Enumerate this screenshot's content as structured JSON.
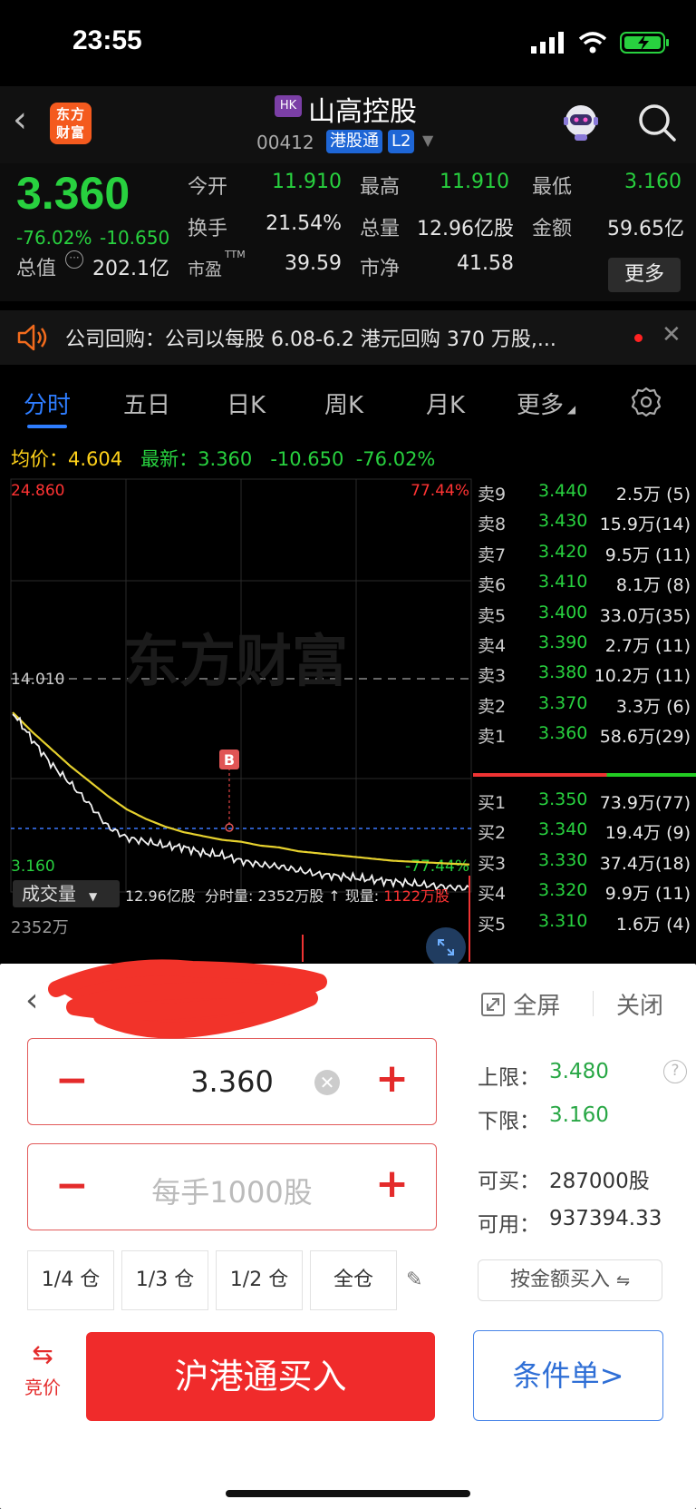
{
  "status_bar": {
    "time": "23:55"
  },
  "header": {
    "logo_text_line1": "东方",
    "logo_text_line2": "财富",
    "market_badge": "HK",
    "stock_name": "山高控股",
    "stock_code": "00412",
    "tag_connect": "港股通",
    "tag_level": "L2"
  },
  "quote": {
    "price": "3.360",
    "change_pct": "-76.02%",
    "change_abs": "-10.650",
    "open_label": "今开",
    "open": "11.910",
    "high_label": "最高",
    "high": "11.910",
    "low_label": "最低",
    "low": "3.160",
    "turnover_label": "换手",
    "turnover": "21.54%",
    "volume_label": "总量",
    "volume": "12.96亿股",
    "amount_label": "金额",
    "amount": "59.65亿",
    "mktcap_label": "总值",
    "mktcap": "202.1亿",
    "pe_label": "市盈",
    "pe_sup": "TTM",
    "pe": "39.59",
    "pb_label": "市净",
    "pb": "41.58",
    "more": "更多"
  },
  "notice": {
    "text": "公司回购：公司以每股 6.08-6.2 港元回购 370 万股,..."
  },
  "tabs": [
    "分时",
    "五日",
    "日K",
    "周K",
    "月K",
    "更多"
  ],
  "chart": {
    "avg_label": "均价：",
    "avg_value": "4.604",
    "latest_label": "最新：",
    "latest_value": "3.360",
    "latest_chg": "-10.650",
    "latest_pct": "-76.02%",
    "y_top": "24.860",
    "y_mid": "14.010",
    "y_bottom": "3.160",
    "pct_top": "77.44%",
    "pct_bottom": "-77.44%",
    "watermark": "东方财富",
    "marker": "B",
    "volume_btn": "成交量",
    "volume_info_total": "12.96亿股",
    "volume_info_tick_label": "分时量:",
    "volume_info_tick": "2352万股",
    "volume_info_now_label": "现量:",
    "volume_info_now": "1122万股",
    "volume_axis_max": "2352万"
  },
  "chart_data": {
    "type": "line",
    "title": "",
    "xlabel": "",
    "ylabel": "",
    "ylim": [
      3.16,
      24.86
    ],
    "series": [
      {
        "name": "最新",
        "values": [
          12.6,
          11.2,
          9.9,
          8.9,
          7.8,
          6.6,
          6.0,
          5.8,
          5.6,
          5.5,
          5.2,
          5.1,
          4.8,
          4.6,
          4.5,
          4.3,
          4.1,
          4.0,
          3.9,
          3.8,
          3.7,
          3.6,
          3.5,
          3.4,
          3.36
        ]
      },
      {
        "name": "均价",
        "values": [
          12.6,
          11.6,
          10.7,
          9.8,
          9.0,
          8.2,
          7.5,
          7.0,
          6.6,
          6.3,
          6.1,
          5.9,
          5.8,
          5.6,
          5.5,
          5.3,
          5.2,
          5.1,
          5.0,
          4.9,
          4.8,
          4.75,
          4.7,
          4.65,
          4.604
        ]
      }
    ]
  },
  "orderbook": {
    "asks": [
      {
        "label": "卖9",
        "price": "3.440",
        "vol": "2.5万 (5)"
      },
      {
        "label": "卖8",
        "price": "3.430",
        "vol": "15.9万(14)"
      },
      {
        "label": "卖7",
        "price": "3.420",
        "vol": "9.5万 (11)"
      },
      {
        "label": "卖6",
        "price": "3.410",
        "vol": "8.1万 (8)"
      },
      {
        "label": "卖5",
        "price": "3.400",
        "vol": "33.0万(35)"
      },
      {
        "label": "卖4",
        "price": "3.390",
        "vol": "2.7万 (11)"
      },
      {
        "label": "卖3",
        "price": "3.380",
        "vol": "10.2万 (11)"
      },
      {
        "label": "卖2",
        "price": "3.370",
        "vol": "3.3万 (6)"
      },
      {
        "label": "卖1",
        "price": "3.360",
        "vol": "58.6万(29)"
      }
    ],
    "bids": [
      {
        "label": "买1",
        "price": "3.350",
        "vol": "73.9万(77)"
      },
      {
        "label": "买2",
        "price": "3.340",
        "vol": "19.4万 (9)"
      },
      {
        "label": "买3",
        "price": "3.330",
        "vol": "37.4万(18)"
      },
      {
        "label": "买4",
        "price": "3.320",
        "vol": "9.9万 (11)"
      },
      {
        "label": "买5",
        "price": "3.310",
        "vol": "1.6万 (4)"
      }
    ]
  },
  "trade": {
    "fullscreen": "全屏",
    "close": "关闭",
    "price_value": "3.360",
    "qty_placeholder": "每手1000股",
    "upper_label": "上限：",
    "upper_value": "3.480",
    "lower_label": "下限：",
    "lower_value": "3.160",
    "can_buy_label": "可买：",
    "can_buy_value": "287000股",
    "available_label": "可用：",
    "available_value": "937394.33",
    "positions": [
      "1/4 仓",
      "1/3 仓",
      "1/2 仓",
      "全仓"
    ],
    "amount_buy": "按金额买入",
    "bid_toggle": "竞价",
    "buy_button": "沪港通买入",
    "condition_button": "条件单>"
  }
}
